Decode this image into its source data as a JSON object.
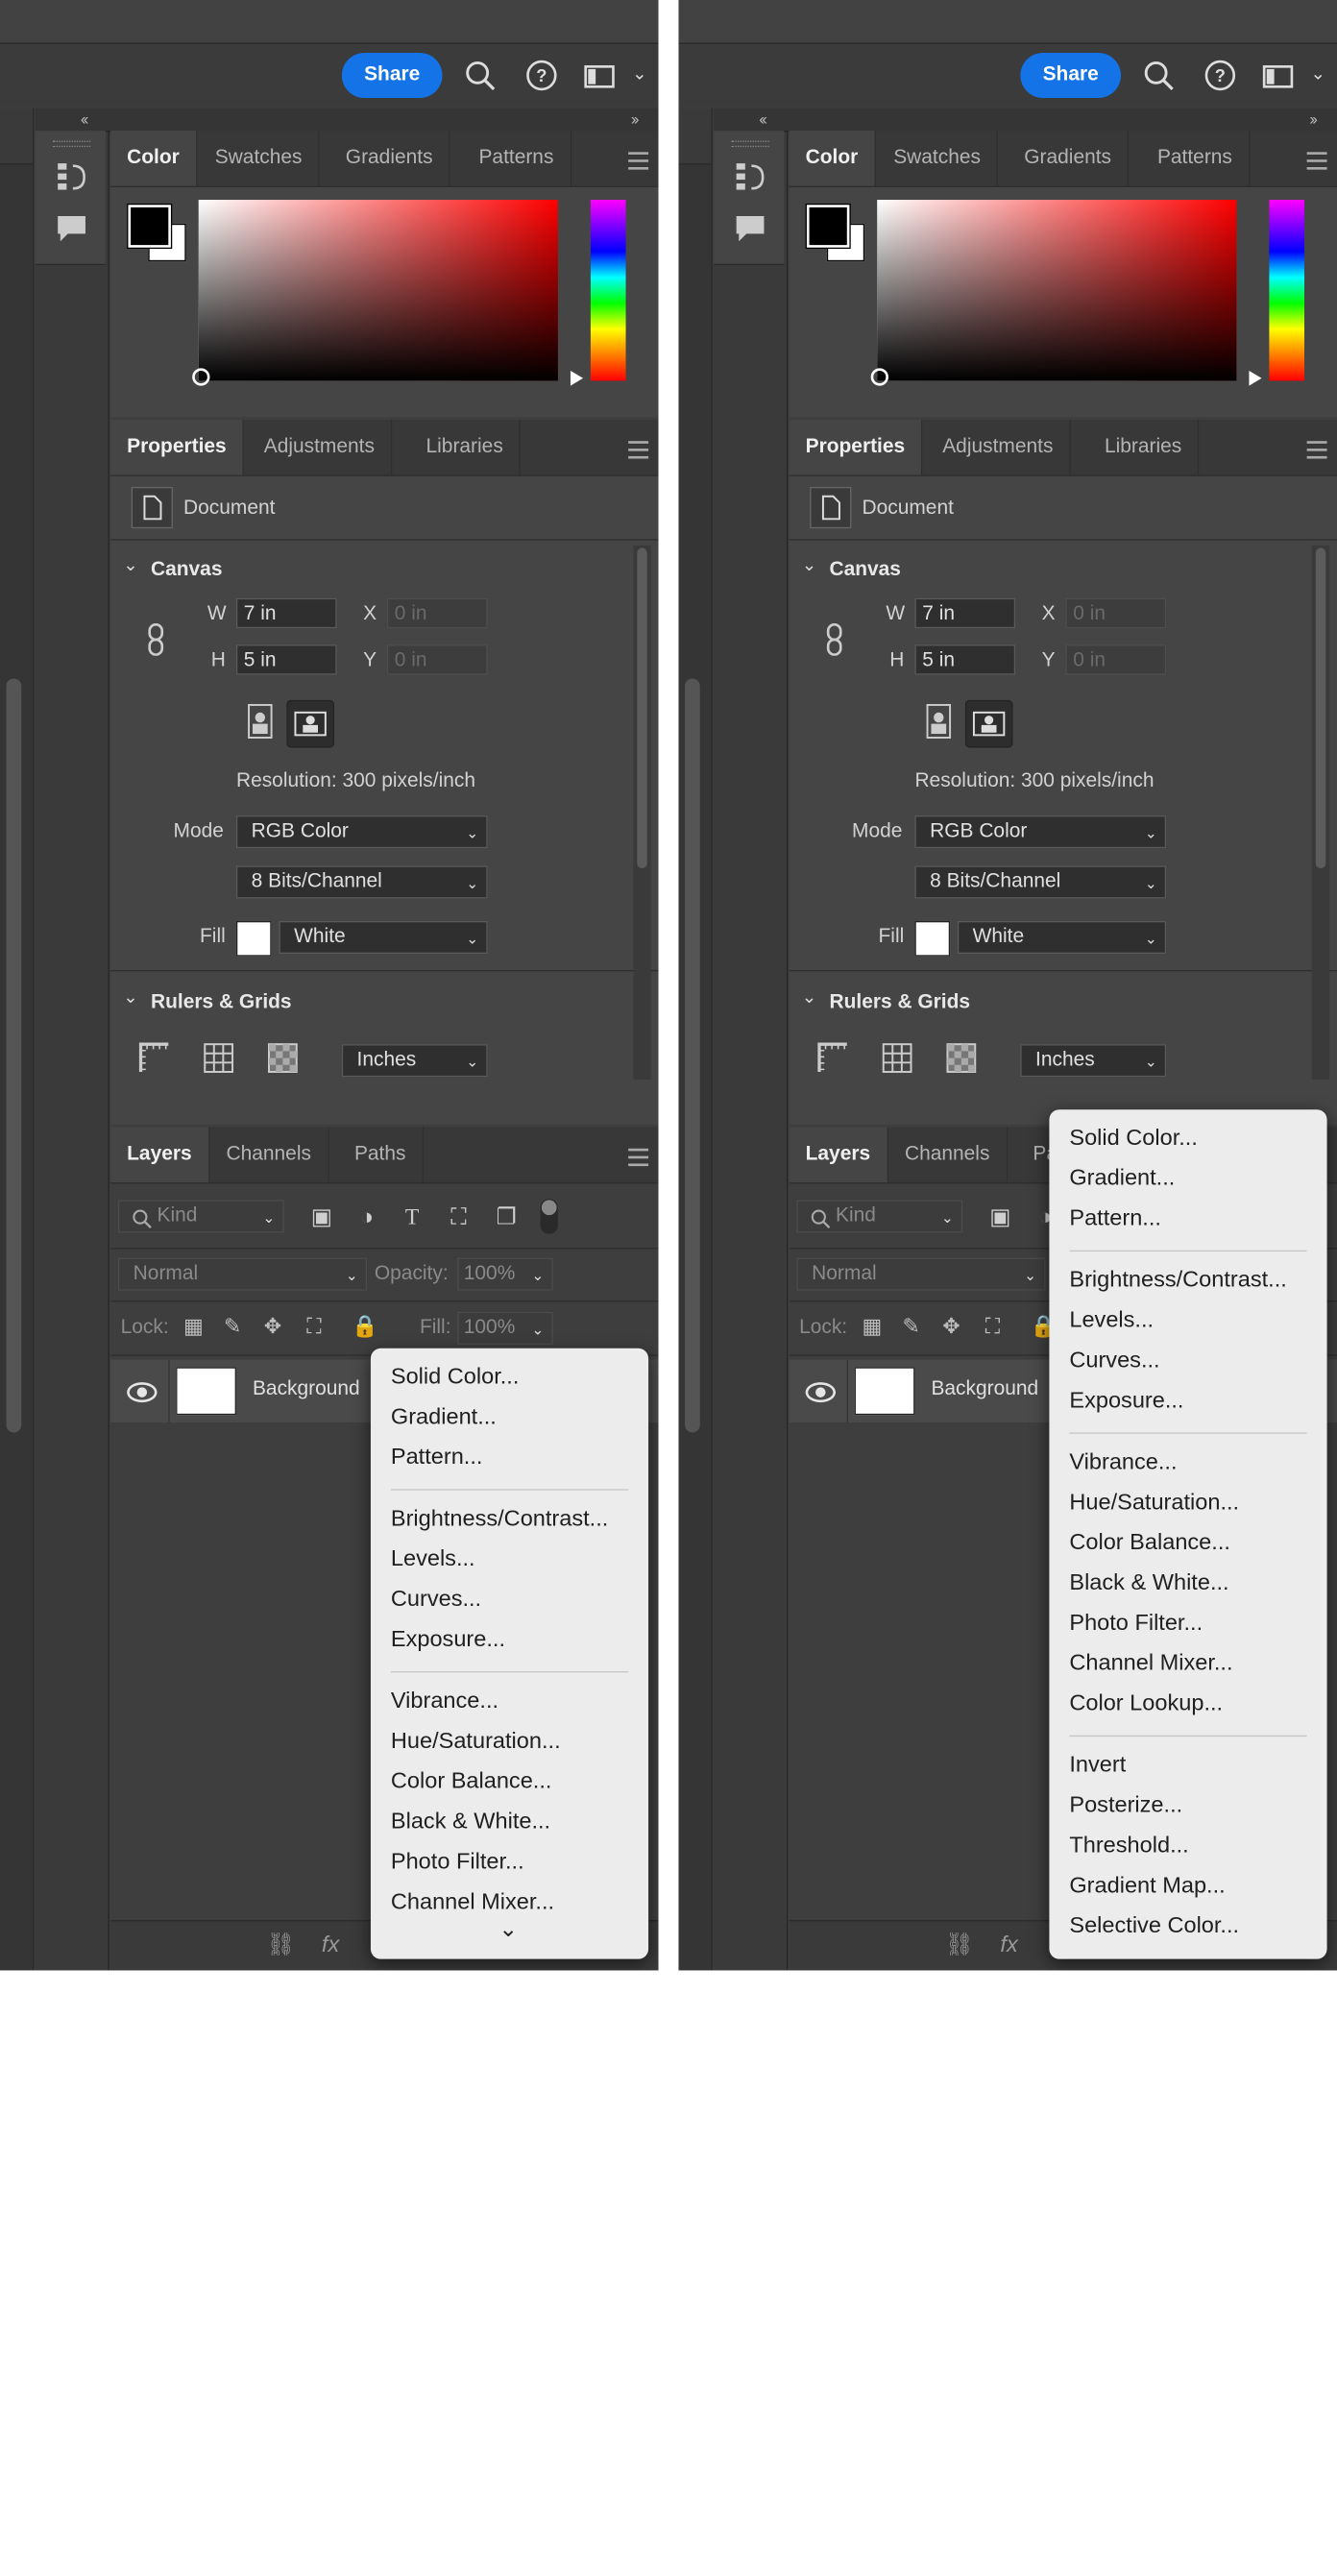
{
  "toolbar": {
    "share_label": "Share"
  },
  "color_panel": {
    "tabs": [
      "Color",
      "Swatches",
      "Gradients",
      "Patterns"
    ],
    "foreground": "#000000",
    "background": "#ffffff",
    "hue_color": "#ff0000"
  },
  "properties_panel": {
    "tabs": [
      "Properties",
      "Adjustments",
      "Libraries"
    ],
    "document_label": "Document",
    "canvas": {
      "section_title": "Canvas",
      "w_label": "W",
      "w_value": "7 in",
      "h_label": "H",
      "h_value": "5 in",
      "x_label": "X",
      "x_value": "0 in",
      "y_label": "Y",
      "y_value": "0 in",
      "resolution": "Resolution: 300 pixels/inch",
      "mode_label": "Mode",
      "mode_value": "RGB Color",
      "bits_value": "8 Bits/Channel",
      "fill_label": "Fill",
      "fill_value": "White",
      "fill_color": "#ffffff"
    },
    "rulers": {
      "section_title": "Rulers & Grids",
      "units": "Inches"
    }
  },
  "layers_panel": {
    "tabs": [
      "Layers",
      "Channels",
      "Paths"
    ],
    "tabs_right_truncated": [
      "Layers",
      "Channels",
      "Pa"
    ],
    "kind_label": "Kind",
    "blend_mode": "Normal",
    "opacity_label": "Opacity:",
    "opacity_value": "100%",
    "lock_label": "Lock:",
    "fill_label": "Fill:",
    "fill_value": "100%",
    "layer_name": "Background"
  },
  "menu_left": {
    "groups": [
      [
        "Solid Color...",
        "Gradient...",
        "Pattern..."
      ],
      [
        "Brightness/Contrast...",
        "Levels...",
        "Curves...",
        "Exposure..."
      ],
      [
        "Vibrance...",
        "Hue/Saturation...",
        "Color Balance...",
        "Black & White...",
        "Photo Filter...",
        "Channel Mixer..."
      ]
    ],
    "more_arrow": "⌄"
  },
  "menu_right": {
    "groups": [
      [
        "Solid Color...",
        "Gradient...",
        "Pattern..."
      ],
      [
        "Brightness/Contrast...",
        "Levels...",
        "Curves...",
        "Exposure..."
      ],
      [
        "Vibrance...",
        "Hue/Saturation...",
        "Color Balance...",
        "Black & White...",
        "Photo Filter...",
        "Channel Mixer...",
        "Color Lookup..."
      ],
      [
        "Invert",
        "Posterize...",
        "Threshold...",
        "Gradient Map...",
        "Selective Color..."
      ]
    ]
  },
  "bottom_icons": {
    "link": "🔗",
    "fx": "fx"
  }
}
